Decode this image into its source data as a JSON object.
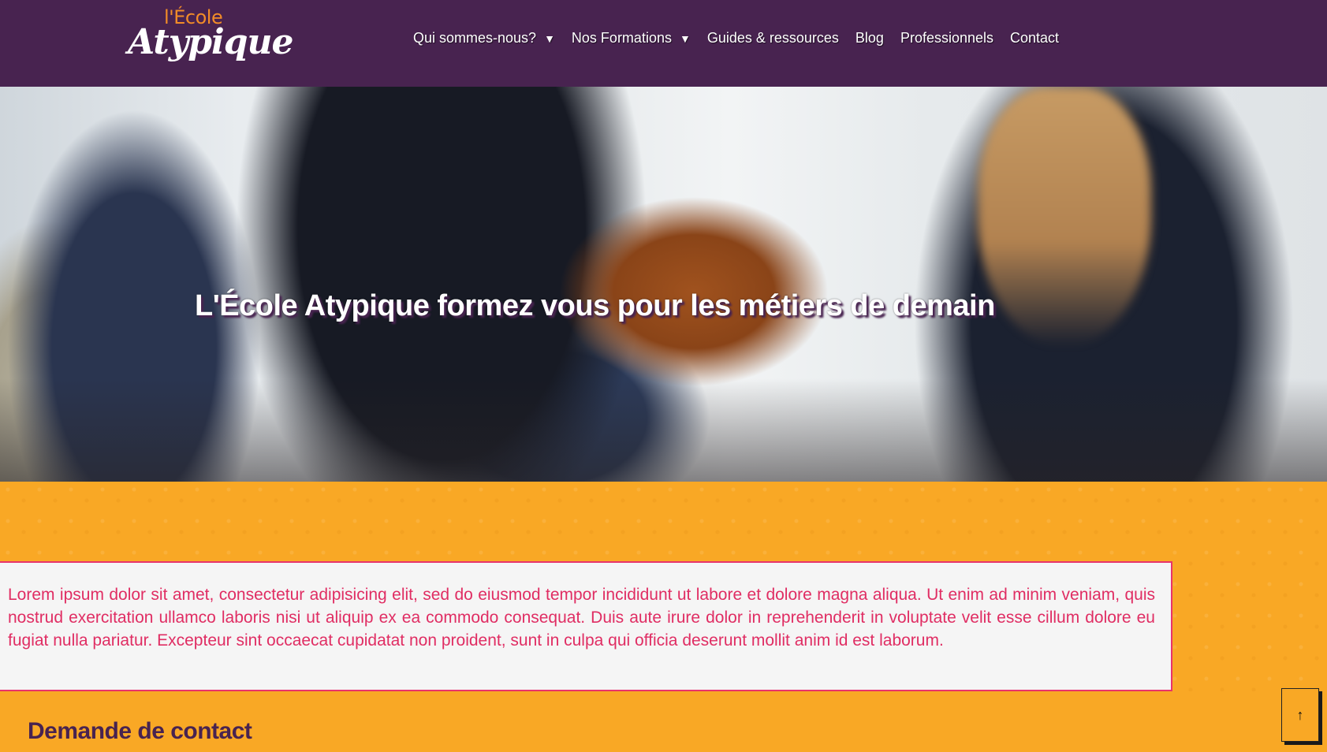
{
  "brand": {
    "logo_small": "l'École",
    "logo_big": "Atypique"
  },
  "nav": {
    "items": [
      {
        "label": "Qui sommes-nous?",
        "has_dropdown": true
      },
      {
        "label": "Nos Formations",
        "has_dropdown": true
      },
      {
        "label": "Guides & ressources",
        "has_dropdown": false
      },
      {
        "label": "Blog",
        "has_dropdown": false
      },
      {
        "label": "Professionnels",
        "has_dropdown": false
      },
      {
        "label": "Contact",
        "has_dropdown": false
      }
    ],
    "caret_glyph": "▼"
  },
  "hero": {
    "title": "L'École Atypique formez vous pour les métiers de demain"
  },
  "intro": {
    "text": "Lorem ipsum dolor sit amet, consectetur adipisicing elit, sed do eiusmod tempor incididunt ut labore et dolore magna aliqua. Ut enim ad minim veniam, quis nostrud exercitation ullamco laboris nisi ut aliquip ex ea commodo consequat. Duis aute irure dolor in reprehenderit in voluptate velit esse cillum dolore eu fugiat nulla pariatur. Excepteur sint occaecat cupidatat non proident, sunt in culpa qui officia deserunt mollit anim id est laborum."
  },
  "contact": {
    "title": "Demande de contact"
  },
  "scroll_top": {
    "glyph": "↑"
  },
  "colors": {
    "header_bg": "#482350",
    "accent_orange": "#f9a825",
    "accent_pink": "#e8336b",
    "logo_orange": "#f28c28"
  }
}
